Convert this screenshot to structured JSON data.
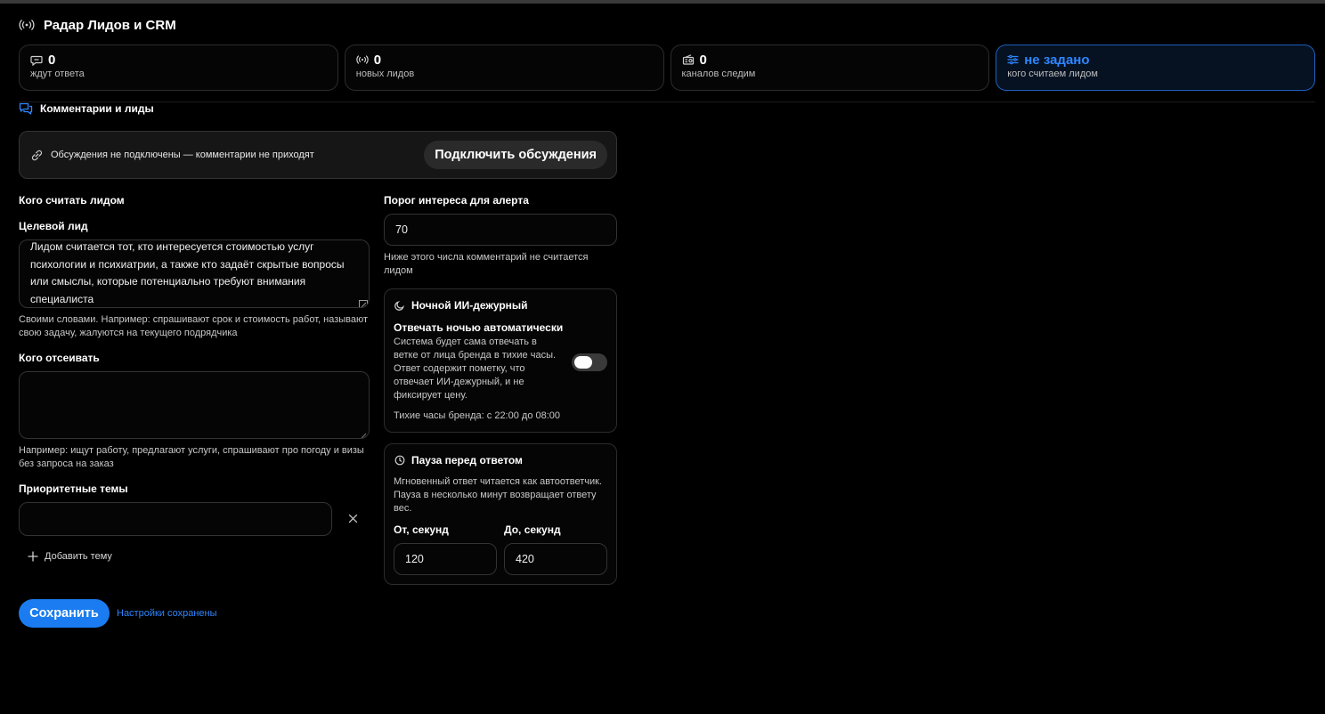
{
  "header": {
    "title": "Радар Лидов и CRM",
    "icon": "radar-icon"
  },
  "stats": [
    {
      "value": "0",
      "label": "ждут ответа",
      "icon": "chat-bubble-icon"
    },
    {
      "value": "0",
      "label": "новых лидов",
      "icon": "broadcast-icon"
    },
    {
      "value": "0",
      "label": "каналов следим",
      "icon": "radio-icon"
    },
    {
      "value": "не задано",
      "label": "кого считаем лидом",
      "icon": "sliders-icon"
    }
  ],
  "section": {
    "title": "Комментарии и лиды",
    "icon": "comments-icon"
  },
  "banner": {
    "message": "Обсуждения не подключены — комментарии не приходят",
    "button": "Подключить обсуждения",
    "icon": "link-icon"
  },
  "lead": {
    "heading": "Кого считать лидом",
    "target_label": "Целевой лид",
    "target_value": "Лидом считается тот, кто интересуется стоимостью услуг психологии и психиатрии, а также кто задаёт скрытые вопросы или смыслы, которые потенциально требуют внимания специалиста",
    "target_hint": "Своими словами. Например: спрашивают срок и стоимость работ, называют свою задачу, жалуются на текущего подрядчика",
    "exclude_label": "Кого отсеивать",
    "exclude_value": "",
    "exclude_hint": "Например: ищут работу, предлагают услуги, спрашивают про погоду и визы без запроса на заказ",
    "priority_label": "Приоритетные темы",
    "priority_value": "",
    "add_topic": "Добавить тему"
  },
  "threshold": {
    "label": "Порог интереса для алерта",
    "value": "70",
    "hint": "Ниже этого числа комментарий не считается лидом"
  },
  "night": {
    "title": "Ночной ИИ-дежурный",
    "option_title": "Отвечать ночью автоматически",
    "option_desc": "Система будет сама отвечать в ветке от лица бренда в тихие часы. Ответ содержит пометку, что отвечает ИИ-дежурный, и не фиксирует цену.",
    "quiet_hours": "Тихие часы бренда: с 22:00 до 08:00",
    "enabled": false
  },
  "pause": {
    "title": "Пауза перед ответом",
    "desc": "Мгновенный ответ читается как автоответчик. Пауза в несколько минут возвращает ответу вес.",
    "from_label": "От, секунд",
    "from_value": "120",
    "to_label": "До, секунд",
    "to_value": "420"
  },
  "footer": {
    "save": "Сохранить",
    "status": "Настройки сохранены"
  },
  "colors": {
    "accent": "#1a7cf0",
    "accent_text": "#2f86ff",
    "background": "#000000"
  }
}
